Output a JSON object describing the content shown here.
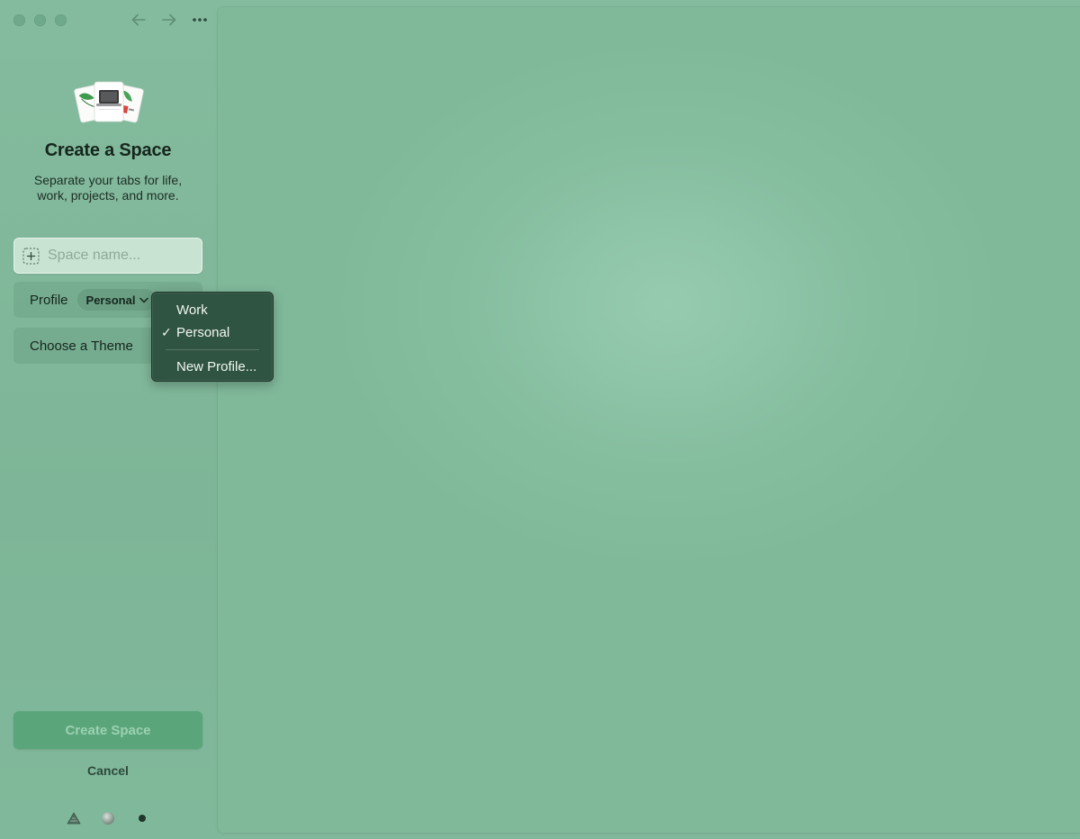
{
  "titlebar": {
    "traffic_lights": [
      "close",
      "minimize",
      "zoom"
    ],
    "back_icon": "arrow-left-icon",
    "forward_icon": "arrow-right-icon",
    "more_icon": "ellipsis-icon"
  },
  "sidebar": {
    "title": "Create a Space",
    "subtitle": "Separate your tabs for life, work, projects, and more.",
    "space_name": {
      "value": "",
      "placeholder": "Space name..."
    },
    "profile": {
      "label": "Profile",
      "selected": "Personal"
    },
    "theme": {
      "label": "Choose a Theme"
    },
    "create_button": "Create Space",
    "cancel_button": "Cancel",
    "bottom_icons": [
      "triangle-icon",
      "globe-icon",
      "dot-icon"
    ]
  },
  "profile_menu": {
    "items": [
      {
        "label": "Work",
        "checked": false
      },
      {
        "label": "Personal",
        "checked": true
      }
    ],
    "new_profile": "New Profile..."
  },
  "colors": {
    "background": "#80b89b",
    "menu_background": "#2f5441",
    "create_button": "#5aa67a"
  }
}
